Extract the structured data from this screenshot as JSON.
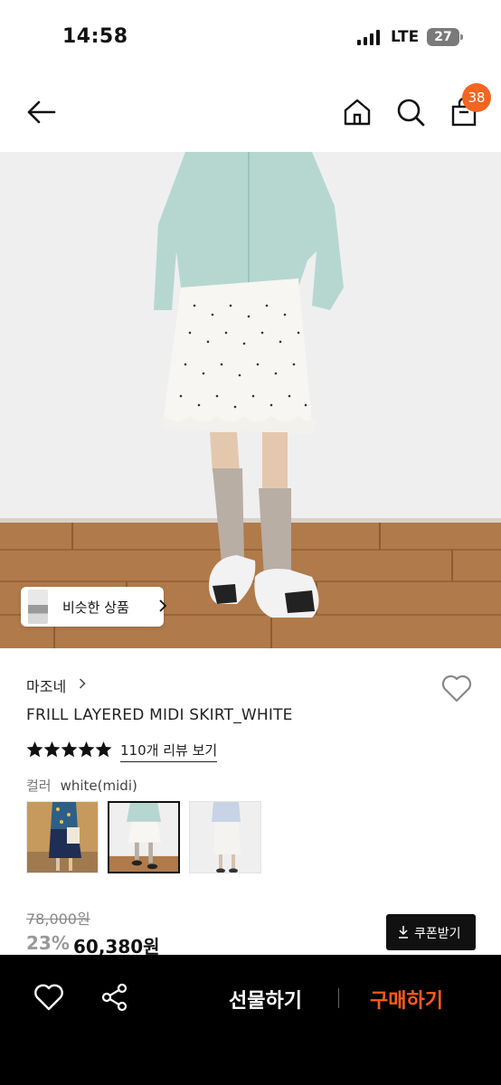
{
  "status_bar": {
    "time": "14:58",
    "network": "LTE",
    "battery": "27"
  },
  "header": {
    "back_icon": "arrow-left-icon",
    "home_icon": "home-icon",
    "search_icon": "search-icon",
    "bag_icon": "shopping-bag-icon",
    "cart_count": "38",
    "badge_color": "#f26522"
  },
  "hero": {
    "similar_button_label": "비슷한 상품"
  },
  "product": {
    "brand": "마조네",
    "title": "FRILL LAYERED MIDI SKIRT_WHITE",
    "rating_stars": 5,
    "review_link": "110개 리뷰 보기",
    "color_label": "컬러",
    "color_value": "white(midi)",
    "selected_option_index": 1,
    "original_price": "78,000원",
    "discount": "23%",
    "price": "60,380원",
    "coupon_label": "쿠폰받기"
  },
  "bottom_bar": {
    "wish_icon": "heart-icon",
    "share_icon": "share-icon",
    "gift_label": "선물하기",
    "buy_label": "구매하기",
    "buy_color": "#ff5a1f"
  }
}
